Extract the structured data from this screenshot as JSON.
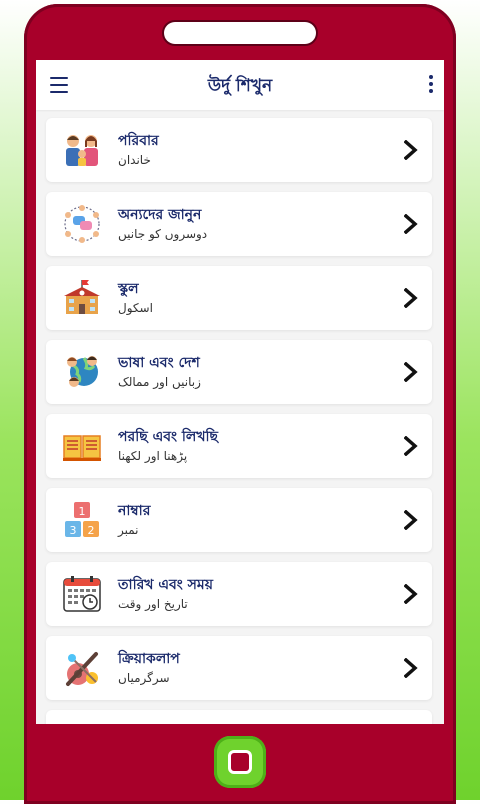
{
  "header": {
    "title": "উর্দু শিখুন",
    "menu_icon": "menu-icon",
    "more_icon": "more-vertical-icon"
  },
  "items": [
    {
      "title": "পরিবার",
      "subtitle": "خاندان",
      "icon": "family-icon"
    },
    {
      "title": "অন্যদের জানুন",
      "subtitle": "دوسروں کو جانیں",
      "icon": "chat-people-icon"
    },
    {
      "title": "স্কুল",
      "subtitle": "اسکول",
      "icon": "school-icon"
    },
    {
      "title": "ভাষা এবং দেশ",
      "subtitle": "زبانیں اور ممالک",
      "icon": "globe-people-icon"
    },
    {
      "title": "পরছি এবং লিখছি",
      "subtitle": "پڑھنا اور لکھنا",
      "icon": "open-book-icon"
    },
    {
      "title": "নাম্বার",
      "subtitle": "نمبر",
      "icon": "number-blocks-icon"
    },
    {
      "title": "তারিখ এবং সময়",
      "subtitle": "تاریخ اور وقت",
      "icon": "calendar-clock-icon"
    },
    {
      "title": "ক্রিয়াকলাপ",
      "subtitle": "سرگرمیاں",
      "icon": "activities-icon"
    }
  ],
  "colors": {
    "frame": "#a8002a",
    "accent_green": "#6fd22d",
    "title_navy": "#1b2a6b"
  }
}
